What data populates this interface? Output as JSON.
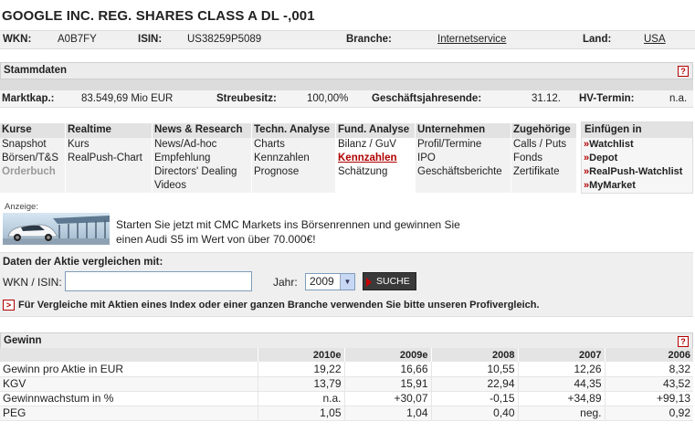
{
  "title": "GOOGLE INC. REG. SHARES CLASS A DL -,001",
  "info": {
    "wkn_label": "WKN:",
    "wkn": "A0B7FY",
    "isin_label": "ISIN:",
    "isin": "US38259P5089",
    "branche_label": "Branche:",
    "branche": "Internetservice",
    "land_label": "Land:",
    "land": "USA"
  },
  "stammdaten": {
    "heading": "Stammdaten",
    "marktkap_label": "Marktkap.:",
    "marktkap": "83.549,69 Mio EUR",
    "streubesitz_label": "Streubesitz:",
    "streubesitz": "100,00%",
    "gj_label": "Geschäftsjahresende:",
    "gj": "31.12.",
    "hv_label": "HV-Termin:",
    "hv": "n.a."
  },
  "help_label": "?",
  "nav": [
    {
      "header": "Kurse",
      "items": [
        "Snapshot",
        "Börsen/T&S",
        "Orderbuch"
      ]
    },
    {
      "header": "Realtime",
      "items": [
        "Kurs",
        "RealPush-Chart"
      ]
    },
    {
      "header": "News & Research",
      "items": [
        "News/Ad-hoc",
        "Empfehlung",
        "Directors' Dealing",
        "Videos"
      ]
    },
    {
      "header": "Techn. Analyse",
      "items": [
        "Charts",
        "Kennzahlen",
        "Prognose"
      ]
    },
    {
      "header": "Fund. Analyse",
      "items": [
        "Bilanz / GuV",
        "Kennzahlen",
        "Schätzung"
      ]
    },
    {
      "header": "Unternehmen",
      "items": [
        "Profil/Termine",
        "IPO",
        "Geschäftsberichte"
      ]
    },
    {
      "header": "Zugehörige",
      "items": [
        "Calls / Puts",
        "Fonds",
        "Zertifikate"
      ]
    }
  ],
  "einfuegen": {
    "header": "Einfügen in",
    "arrow": "»",
    "items": [
      "Watchlist",
      "Depot",
      "RealPush-Watchlist",
      "MyMarket"
    ]
  },
  "ad": {
    "label": "Anzeige:",
    "line1": "Starten Sie jetzt mit CMC Markets ins Börsenrennen und gewinnen Sie",
    "line2": "einen Audi S5 im Wert von über 70.000€!"
  },
  "compare": {
    "title": "Daten der Aktie vergleichen mit:",
    "wkn_label": "WKN / ISIN:",
    "wkn_value": "",
    "jahr_label": "Jahr:",
    "jahr_value": "2009",
    "button": "SUCHE",
    "note_icon": ">",
    "note": "Für Vergleiche mit Aktien eines Index oder einer ganzen Branche verwenden Sie bitte unseren Profivergleich."
  },
  "gewinn": {
    "heading": "Gewinn",
    "columns": [
      "2010e",
      "2009e",
      "2008",
      "2007",
      "2006"
    ],
    "rows": [
      {
        "label": "Gewinn pro Aktie in EUR",
        "values": [
          "19,22",
          "16,66",
          "10,55",
          "12,26",
          "8,32"
        ]
      },
      {
        "label": "KGV",
        "values": [
          "13,79",
          "15,91",
          "22,94",
          "44,35",
          "43,52"
        ]
      },
      {
        "label": "Gewinnwachstum in %",
        "values": [
          "n.a.",
          "+30,07",
          "-0,15",
          "+34,89",
          "+99,13"
        ]
      },
      {
        "label": "PEG",
        "values": [
          "1,05",
          "1,04",
          "0,40",
          "neg.",
          "0,92"
        ]
      }
    ]
  }
}
